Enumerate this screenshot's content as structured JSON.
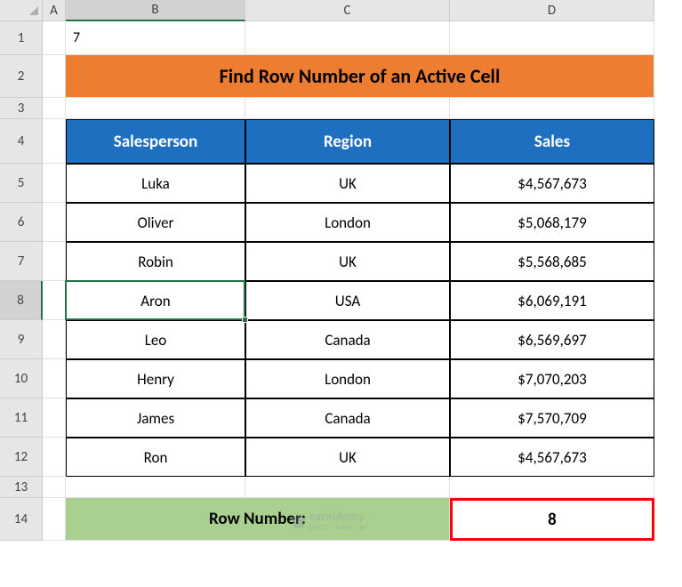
{
  "cols": [
    "A",
    "B",
    "C",
    "D"
  ],
  "rows": [
    "1",
    "2",
    "3",
    "4",
    "5",
    "6",
    "7",
    "8",
    "9",
    "10",
    "11",
    "12",
    "13",
    "14"
  ],
  "formula_bar_value": "7",
  "active_col": "B",
  "active_row": "8",
  "title": "Find Row Number of an Active Cell",
  "headers": {
    "b": "Salesperson",
    "c": "Region",
    "d": "Sales"
  },
  "data": [
    {
      "b": "Luka",
      "c": "UK",
      "d": "$4,567,673"
    },
    {
      "b": "Oliver",
      "c": "London",
      "d": "$5,068,179"
    },
    {
      "b": "Robin",
      "c": "UK",
      "d": "$5,568,685"
    },
    {
      "b": "Aron",
      "c": "USA",
      "d": "$6,069,191"
    },
    {
      "b": "Leo",
      "c": "Canada",
      "d": "$6,569,697"
    },
    {
      "b": "Henry",
      "c": "London",
      "d": "$7,070,203"
    },
    {
      "b": "James",
      "c": "Canada",
      "d": "$7,570,709"
    },
    {
      "b": "Ron",
      "c": "UK",
      "d": "$4,567,673"
    }
  ],
  "result": {
    "label": "Row Number:",
    "value": "8"
  },
  "watermark": {
    "main": "exceldemy",
    "sub": "EXCEL · DATA · BI"
  },
  "chart_data": {
    "type": "table",
    "title": "Find Row Number of an Active Cell",
    "columns": [
      "Salesperson",
      "Region",
      "Sales"
    ],
    "rows": [
      [
        "Luka",
        "UK",
        4567673
      ],
      [
        "Oliver",
        "London",
        5068179
      ],
      [
        "Robin",
        "UK",
        5568685
      ],
      [
        "Aron",
        "USA",
        6069191
      ],
      [
        "Leo",
        "Canada",
        6569697
      ],
      [
        "Henry",
        "London",
        7070203
      ],
      [
        "James",
        "Canada",
        7570709
      ],
      [
        "Ron",
        "UK",
        4567673
      ]
    ],
    "row_number_result": 8
  }
}
